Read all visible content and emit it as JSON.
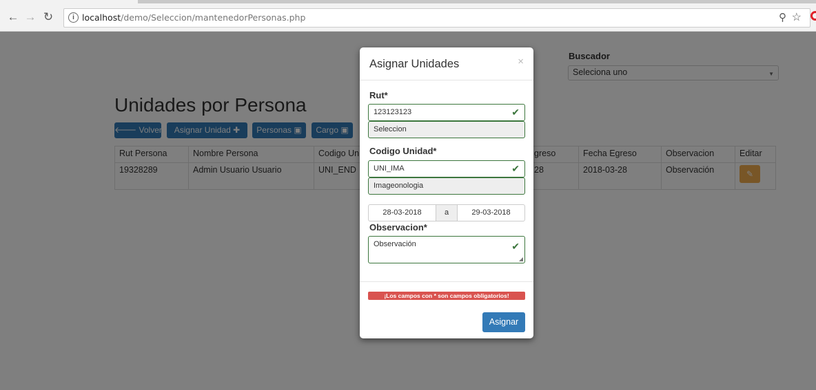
{
  "browser": {
    "url_host": "localhost",
    "url_path": "/demo/Seleccion/mantenedorPersonas.php"
  },
  "page": {
    "title": "Unidades por Persona",
    "buscador_label": "Buscador",
    "buscador_value": "Seleciona uno",
    "buttons": {
      "volver": "Volver",
      "asignar_unidad": "Asignar Unidad",
      "personas": "Personas",
      "cargo": "Cargo"
    },
    "table": {
      "headers": [
        "Rut Persona",
        "Nombre Persona",
        "Codigo Un",
        "greso",
        "Fecha Egreso",
        "Observacion",
        "Editar"
      ],
      "rows": [
        [
          "19328289",
          "Admin Usuario Usuario",
          "UNI_END",
          "28",
          "2018-03-28",
          "Observación"
        ]
      ]
    }
  },
  "modal": {
    "title": "Asignar Unidades",
    "close": "×",
    "rut_label": "Rut*",
    "rut_value": "123123123",
    "rut_desc": "Seleccion",
    "codigo_label": "Codigo Unidad*",
    "codigo_value": "UNI_IMA",
    "codigo_desc": "Imageonologia",
    "fecha_inicio": "28-03-2018",
    "fecha_sep": "a",
    "fecha_fin": "29-03-2018",
    "obs_label": "Observacion*",
    "obs_value": "Observación",
    "alert": "¡Los campos con * son campos obligatorios!",
    "submit": "Asignar"
  },
  "colors": {
    "primary": "#337ab7",
    "success": "#3c763d",
    "danger": "#d9534f",
    "warning": "#f0ad4e"
  }
}
